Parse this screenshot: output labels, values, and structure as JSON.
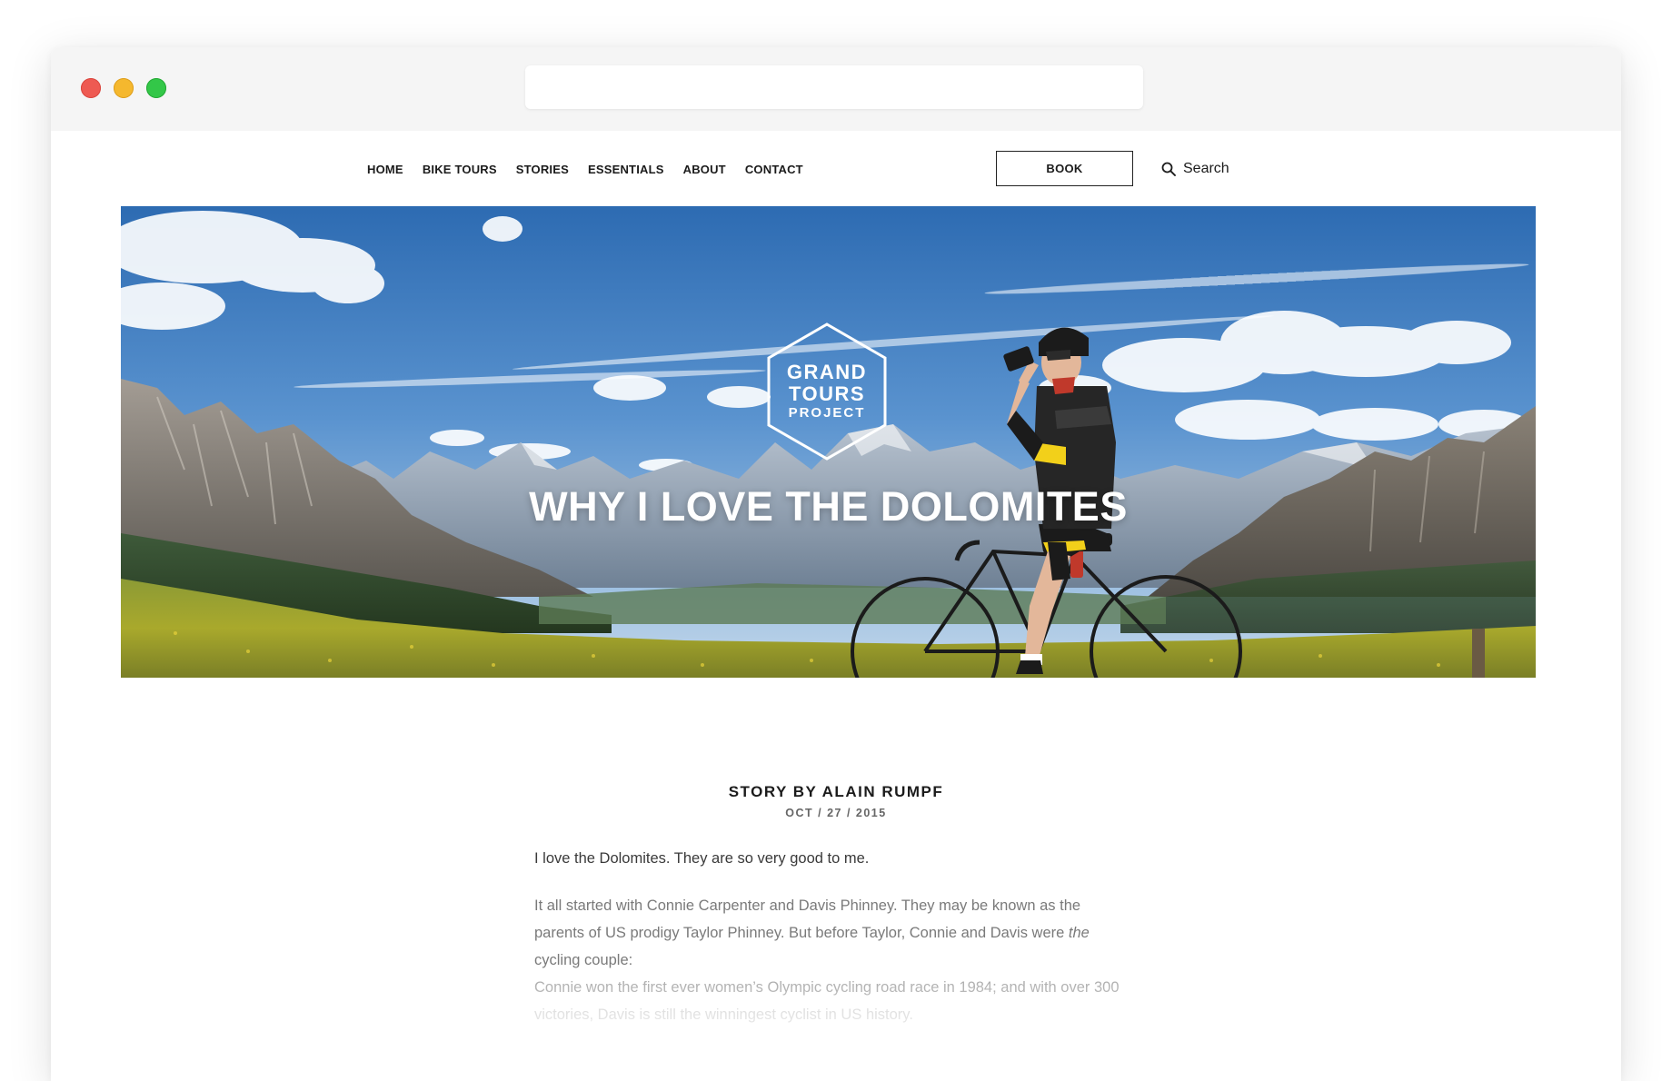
{
  "nav": {
    "links": [
      "HOME",
      "BIKE TOURS",
      "STORIES",
      "ESSENTIALS",
      "ABOUT",
      "CONTACT"
    ],
    "book_label": "BOOK",
    "search_label": "Search"
  },
  "hero": {
    "logo": {
      "line1": "GRAND",
      "line2": "TOURS",
      "line3": "PROJECT"
    },
    "title": "WHY I LOVE THE DOLOMITES"
  },
  "article": {
    "byline": "STORY BY ALAIN RUMPF",
    "date": "OCT / 27 / 2015",
    "intro": "I love the Dolomites. They are so very good to me.",
    "p2_before_em": "It all started with Connie Carpenter and Davis Phinney. They may be known as the parents of US prodigy Taylor Phinney. But before Taylor, Connie and Davis were ",
    "p2_em": "the",
    "p2_after_em": " cycling couple:",
    "p2_line3": "Connie won the first ever women’s Olympic cycling road race in 1984; and with over 300",
    "p2_line4": "victories, Davis is still the winningest cyclist in US history."
  },
  "colors": {
    "sky_top": "#2f6fb5",
    "sky_bottom": "#8fb6de",
    "meadow": "#9aa82e",
    "accent_yellow": "#f2d01a"
  },
  "icons": [
    "search-icon",
    "grand-tours-hexagon-logo"
  ]
}
